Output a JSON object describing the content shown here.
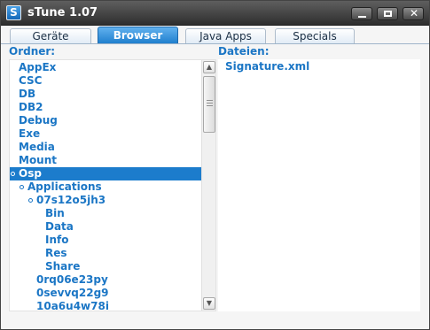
{
  "window": {
    "title": "sTune 1.07",
    "icon_letter": "S"
  },
  "tabs": [
    {
      "label": "Geräte",
      "active": false
    },
    {
      "label": "Browser",
      "active": true
    },
    {
      "label": "Java Apps",
      "active": false
    },
    {
      "label": "Specials",
      "active": false
    }
  ],
  "folders_panel": {
    "label": "Ordner:",
    "items": [
      {
        "label": "AppEx",
        "depth": 0,
        "expanded": false,
        "selected": false
      },
      {
        "label": "CSC",
        "depth": 0,
        "expanded": false,
        "selected": false
      },
      {
        "label": "DB",
        "depth": 0,
        "expanded": false,
        "selected": false
      },
      {
        "label": "DB2",
        "depth": 0,
        "expanded": false,
        "selected": false
      },
      {
        "label": "Debug",
        "depth": 0,
        "expanded": false,
        "selected": false
      },
      {
        "label": "Exe",
        "depth": 0,
        "expanded": false,
        "selected": false
      },
      {
        "label": "Media",
        "depth": 0,
        "expanded": false,
        "selected": false
      },
      {
        "label": "Mount",
        "depth": 0,
        "expanded": false,
        "selected": false
      },
      {
        "label": "Osp",
        "depth": 0,
        "expanded": true,
        "selected": true
      },
      {
        "label": "Applications",
        "depth": 1,
        "expanded": true,
        "selected": false
      },
      {
        "label": "07s12o5jh3",
        "depth": 2,
        "expanded": true,
        "selected": false
      },
      {
        "label": "Bin",
        "depth": 3,
        "expanded": false,
        "selected": false
      },
      {
        "label": "Data",
        "depth": 3,
        "expanded": false,
        "selected": false
      },
      {
        "label": "Info",
        "depth": 3,
        "expanded": false,
        "selected": false
      },
      {
        "label": "Res",
        "depth": 3,
        "expanded": false,
        "selected": false
      },
      {
        "label": "Share",
        "depth": 3,
        "expanded": false,
        "selected": false
      },
      {
        "label": "0rq06e23py",
        "depth": 2,
        "expanded": false,
        "selected": false
      },
      {
        "label": "0sevvq22g9",
        "depth": 2,
        "expanded": false,
        "selected": false
      },
      {
        "label": "10a6u4w78i",
        "depth": 2,
        "expanded": false,
        "selected": false
      }
    ]
  },
  "files_panel": {
    "label": "Dateien:",
    "items": [
      "Signature.xml"
    ]
  },
  "colors": {
    "accent": "#1c7ccc",
    "link_text": "#1b76c5",
    "titlebar": "#3a3a3a"
  }
}
